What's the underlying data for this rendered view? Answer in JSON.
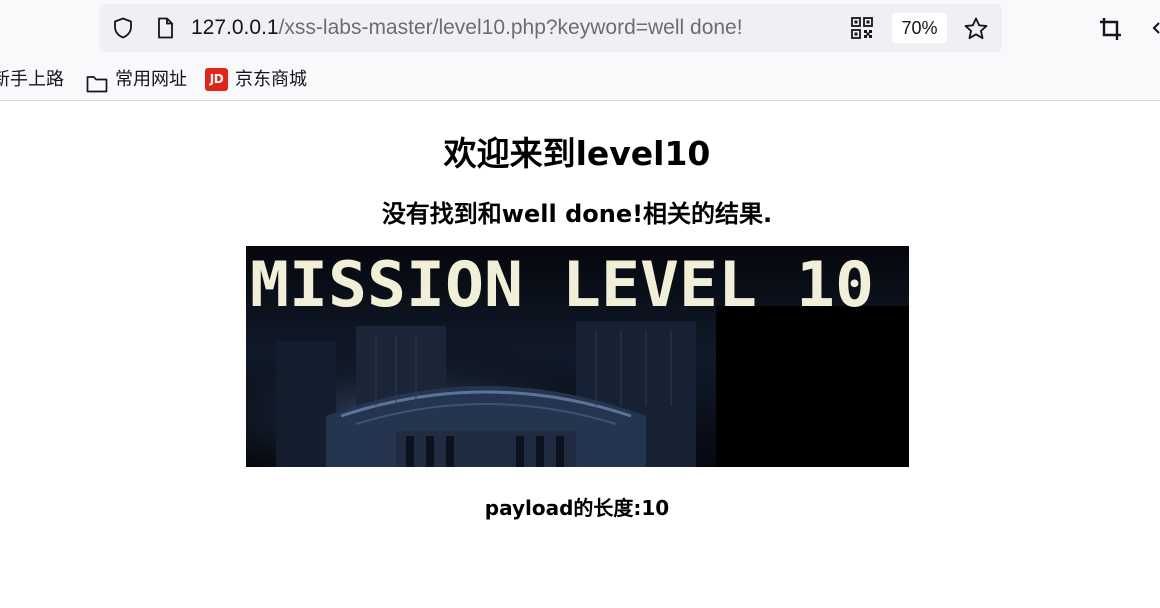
{
  "browser": {
    "url_host": "127.0.0.1",
    "url_path": "/xss-labs-master/level10.php?keyword=well done!",
    "zoom": "70%",
    "icons": [
      "shield-icon",
      "page-icon",
      "qr-code-icon",
      "star-icon",
      "crop-icon"
    ]
  },
  "bookmarks": [
    {
      "label": "新手上路",
      "icon": "none"
    },
    {
      "label": "常用网址",
      "icon": "folder-icon"
    },
    {
      "label": "京东商城",
      "icon": "jd-icon"
    }
  ],
  "jd_icon_text": "JD",
  "page": {
    "heading": "欢迎来到level10",
    "result": "没有找到和well done!相关的结果.",
    "banner_text": "MISSION LEVEL 10",
    "payload_length": "payload的长度:10"
  }
}
